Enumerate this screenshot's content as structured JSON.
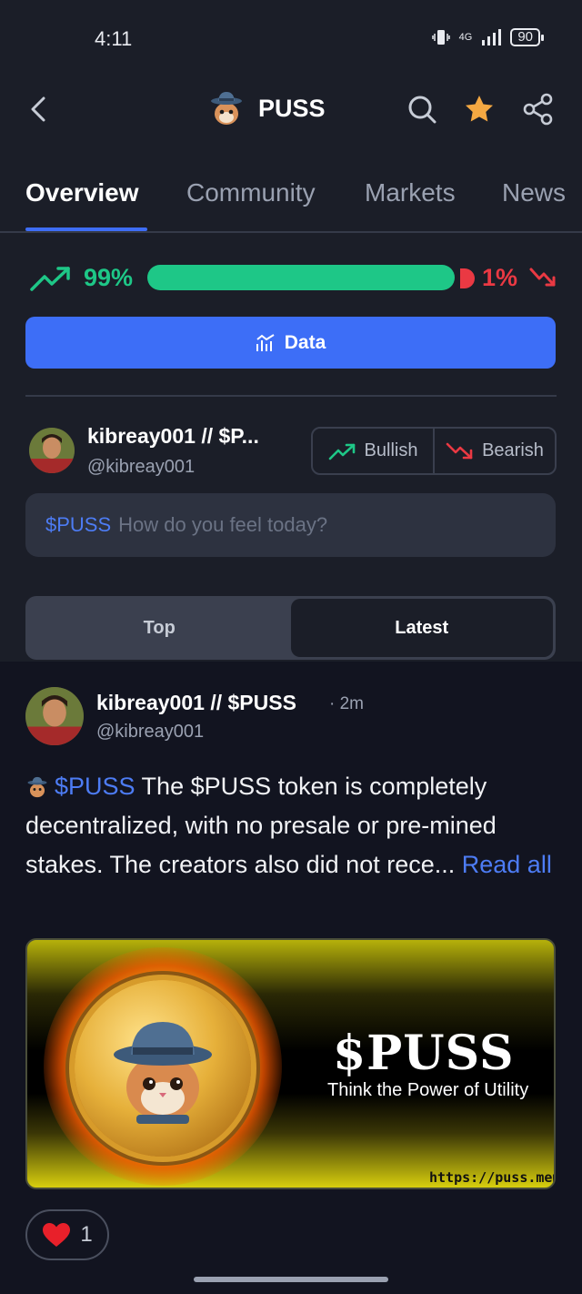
{
  "status_bar": {
    "time": "4:11",
    "network": "4G",
    "battery": "90"
  },
  "header": {
    "title": "PUSS"
  },
  "tabs": [
    {
      "label": "Overview",
      "active": true
    },
    {
      "label": "Community",
      "active": false
    },
    {
      "label": "Markets",
      "active": false
    },
    {
      "label": "News",
      "active": false
    }
  ],
  "sentiment": {
    "bullish_pct": "99%",
    "bearish_pct": "1%",
    "bullish_fraction": 0.99,
    "bullish_color": "#1ec787",
    "bearish_color": "#ea3943"
  },
  "data_button": {
    "label": "Data"
  },
  "composer": {
    "user_name": "kibreay001 // $P...",
    "user_handle": "@kibreay001",
    "bullish_label": "Bullish",
    "bearish_label": "Bearish",
    "input_tag": "$PUSS",
    "input_placeholder": "How do you feel today?"
  },
  "sort": {
    "top_label": "Top",
    "latest_label": "Latest",
    "selected": "Latest"
  },
  "post": {
    "user_name": "kibreay001 // $PUSS",
    "time": "· 2m",
    "user_handle": "@kibreay001",
    "tag": "$PUSS",
    "text": " The $PUSS token is completely decentralized, with no presale or pre-mined stakes. The creators also did not rece...",
    "read_more": " Read all",
    "banner": {
      "title": "$PUSS",
      "subtitle": "Think the Power of Utility",
      "url": "https://puss.meme"
    },
    "likes": "1"
  },
  "colors": {
    "accent": "#3d6ef7",
    "background": "#1b1e28",
    "feed_background": "#121420"
  }
}
